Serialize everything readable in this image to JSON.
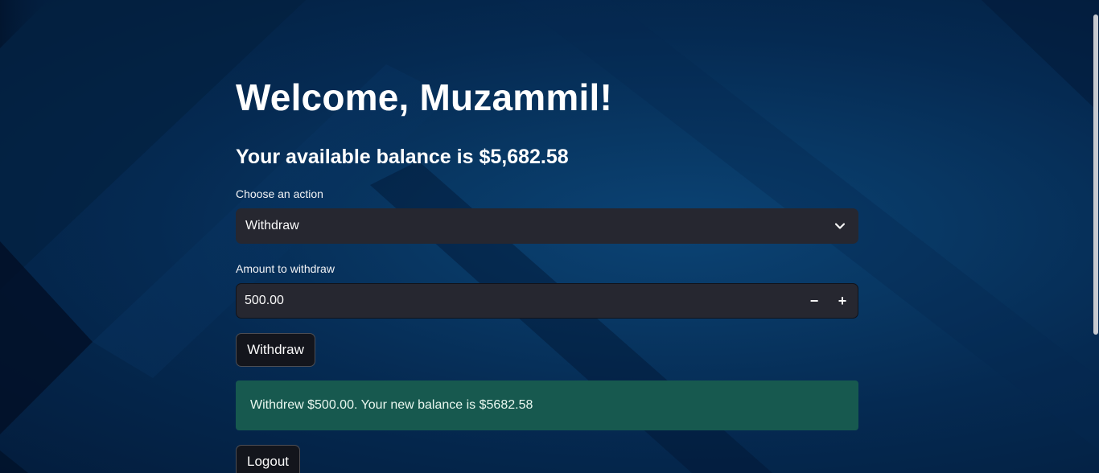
{
  "page": {
    "welcome": "Welcome, Muzammil!",
    "balance_text": "Your available balance is $5,682.58"
  },
  "action": {
    "label": "Choose an action",
    "selected": "Withdraw"
  },
  "amount": {
    "label": "Amount to withdraw",
    "value": "500.00",
    "minus": "−",
    "plus": "+"
  },
  "buttons": {
    "withdraw": "Withdraw",
    "logout": "Logout"
  },
  "alert": {
    "message": "Withdrew $500.00. Your new balance is $5682.58"
  },
  "icons": {
    "select": "chevron-down-icon",
    "decrement": "minus-icon",
    "increment": "plus-icon"
  },
  "colors": {
    "background": "#06294f",
    "input_background": "#262730",
    "success_background": "#17594f",
    "button_background": "#13151c",
    "text": "#ffffff"
  }
}
